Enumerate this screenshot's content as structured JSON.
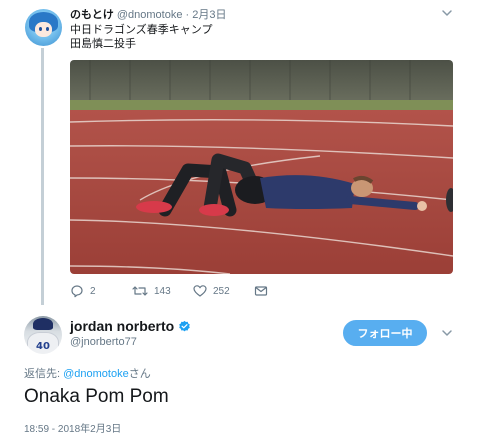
{
  "parent_tweet": {
    "name": "のもとけ",
    "handle": "@dnomotoke",
    "dot": "·",
    "time": "2月3日",
    "text_line1": "中日ドラゴンズ春季キャンプ",
    "text_line2": "田島慎二投手",
    "media_icon": "photo-runner-lying-on-track",
    "actions": {
      "reply_count": "2",
      "retweet_count": "143",
      "like_count": "252",
      "reply_icon": "reply-icon",
      "retweet_icon": "retweet-icon",
      "like_icon": "heart-icon",
      "dm_icon": "mail-icon"
    }
  },
  "reply_tweet": {
    "name": "jordan norberto",
    "verified_icon": "verified-badge-icon",
    "handle": "@jnorberto77",
    "avatar_number": "40",
    "follow_label": "フォロー中",
    "reply_to_prefix": "返信先: ",
    "reply_to_mention": "@dnomotoke",
    "reply_to_suffix": "さん",
    "text": "Onaka Pom Pom",
    "timestamp": "18:59 - 2018年2月3日"
  },
  "colors": {
    "accent": "#1da1f2",
    "follow_button": "#58aef0",
    "secondary_text": "#657786",
    "thread_line": "#c4cfd6",
    "track": "#a8483f"
  }
}
